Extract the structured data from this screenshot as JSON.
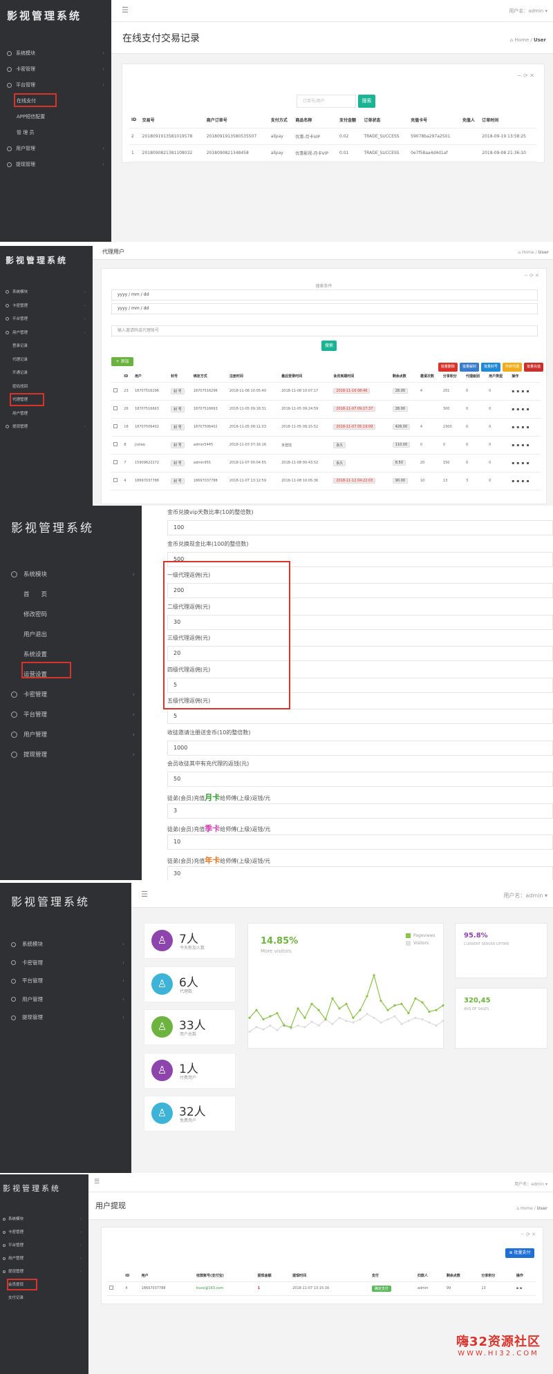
{
  "brand": "影视管理系统",
  "user": "用户名：admin",
  "home": "Home",
  "crumb": "User",
  "s1": {
    "title": "在线支付交易记录",
    "nav": [
      {
        "label": "系统模块"
      },
      {
        "label": "卡密管理"
      },
      {
        "label": "平台管理"
      },
      {
        "label": "在线支付",
        "child": true
      },
      {
        "label": "APP短信配置",
        "child": true
      },
      {
        "label": "管 理 员",
        "child": true
      },
      {
        "label": "用户管理"
      },
      {
        "label": "提现管理"
      }
    ],
    "search_placeholder": "订单号/商户",
    "search_btn": "搜索",
    "headers": [
      "ID",
      "交易号",
      "商户订单号",
      "支付方式",
      "商品名称",
      "支付金额",
      "订单状态",
      "充值卡号",
      "充值人",
      "订单时间"
    ],
    "rows": [
      [
        "2",
        "2018091913581019578",
        "2018091913580535507",
        "alipay",
        "优惠-月卡VIP",
        "0.02",
        "TRADE_SUCCESS",
        "59078ba297a2501",
        "",
        "2018-09-19 13:58:25"
      ],
      [
        "1",
        "2018090821381108032",
        "2018090821348458",
        "alipay",
        "优惠影视-月卡VIP",
        "0.01",
        "TRADE_SUCCESS",
        "0e7f58aa4d4d1af",
        "",
        "2018-09-08 21:36:10"
      ]
    ]
  },
  "s2": {
    "title": "代理用户",
    "nav": [
      {
        "label": "系统模块"
      },
      {
        "label": "卡密管理"
      },
      {
        "label": "平台管理"
      },
      {
        "label": "用户管理"
      },
      {
        "label": "登录记录",
        "child": true
      },
      {
        "label": "代理记录",
        "child": true
      },
      {
        "label": "开通记录",
        "child": true
      },
      {
        "label": "密码找回",
        "child": true
      },
      {
        "label": "代理管理",
        "child": true
      },
      {
        "label": "用户管理",
        "child": true
      },
      {
        "label": "提现管理"
      }
    ],
    "filter_label": "搜索条件",
    "date1": "yyyy / mm / dd",
    "date2": "yyyy / mm / dd",
    "keyword": "输入邀请码或代理账号",
    "search_btn": "搜索",
    "add_btn": "添加",
    "action_btns": [
      {
        "label": "批量删除",
        "color": "#d9342b"
      },
      {
        "label": "批量解封",
        "color": "#3a7ccc"
      },
      {
        "label": "批量封号",
        "color": "#1f89d6"
      },
      {
        "label": "开启代理",
        "color": "#f0ad1e"
      },
      {
        "label": "批量充值",
        "color": "#c9302c"
      }
    ],
    "headers": [
      "",
      "ID",
      "用户",
      "封号",
      "绑定方式",
      "注册时间",
      "最后登录时间",
      "会员到期时间",
      "剩余点数",
      "邀请次数",
      "分享积分",
      "代理级别",
      "用户类型",
      "操作"
    ],
    "rows": [
      [
        "",
        "23",
        "18707516296",
        "封 号",
        "18707516296",
        "2018-11-08 10:05:40",
        "2018-11-08 10:07:17",
        "2018-11-16 08:46",
        "28.00",
        "4",
        "201",
        "0",
        "0"
      ],
      [
        "",
        "26",
        "18707516663",
        "封 号",
        "18707516663",
        "2018-11-05 09:18:31",
        "2018-11-05 09:24:59",
        "2018-11-07 09:27:37",
        "28.00",
        "",
        "300",
        "0",
        "0"
      ],
      [
        "",
        "18",
        "18707506402",
        "封 号",
        "18707506402",
        "2018-11-05 08:11:03",
        "2018-11-05 08:15:52",
        "2018-11-07 05:19:09",
        "426.00",
        "4",
        "2300",
        "0",
        "0"
      ],
      [
        "",
        "8",
        "jiuliao",
        "封 号",
        "admin5445",
        "2018-11-03 07:16:16",
        "未登陆",
        "永久",
        "110.00",
        "0",
        "0",
        "0",
        "0"
      ],
      [
        "",
        "7",
        "15909622272",
        "封 号",
        "admin955",
        "2018-11-07 00:04:55",
        "2018-11-08 00:43:52",
        "永久",
        "8.50",
        "20",
        "150",
        "0",
        "0"
      ],
      [
        "",
        "4",
        "18697037788",
        "封 号",
        "18697037788",
        "2018-11-07 13:12:59",
        "2018-11-08 10:05:36",
        "2018-11-12 04:22:03",
        "90.00",
        "10",
        "13",
        "3",
        "0"
      ]
    ]
  },
  "s3": {
    "nav": [
      {
        "label": "系统模块"
      },
      {
        "label": "首　　页",
        "child": true
      },
      {
        "label": "修改密码",
        "child": true
      },
      {
        "label": "用户退出",
        "child": true
      },
      {
        "label": "系统设置",
        "child": true
      },
      {
        "label": "运营设置",
        "child": true
      },
      {
        "label": "卡密管理"
      },
      {
        "label": "平台管理"
      },
      {
        "label": "用户管理"
      },
      {
        "label": "提现管理"
      }
    ],
    "fields": [
      {
        "label": "金币兑换vip天数比率(10的整倍数)",
        "value": "100"
      },
      {
        "label": "金币兑换现金比率(100的整倍数)",
        "value": "500"
      },
      {
        "label": "一级代理返佣(元)",
        "value": "200"
      },
      {
        "label": "二级代理返佣(元)",
        "value": "30"
      },
      {
        "label": "三级代理返佣(元)",
        "value": "20"
      },
      {
        "label": "四级代理返佣(元)",
        "value": "5"
      },
      {
        "label": "五级代理返佣(元)",
        "value": "5"
      },
      {
        "label": "收徒邀请注册送金币(10的整倍数)",
        "value": "1000"
      },
      {
        "label": "会员收徒其中有充代理的返钱(元)",
        "value": "50"
      },
      {
        "label_pre": "徒弟(会员)充值",
        "label_em": "月卡",
        "em_color": "#2f9a2f",
        "label_post": "给师傅(上级)返钱/元",
        "value": "3"
      },
      {
        "label_pre": "徒弟(会员)充值",
        "label_em": "季卡",
        "em_color": "#d63fb4",
        "label_post": "给师傅(上级)返钱/元",
        "value": "10"
      },
      {
        "label_pre": "徒弟(会员)充值",
        "label_em": "年卡",
        "em_color": "#e8741e",
        "label_post": "给师傅(上级)返钱/元",
        "value": "30"
      }
    ]
  },
  "s4": {
    "nav": [
      {
        "label": "系统模块"
      },
      {
        "label": "卡密管理"
      },
      {
        "label": "平台管理"
      },
      {
        "label": "用户管理"
      },
      {
        "label": "提现管理"
      }
    ],
    "stats": [
      {
        "value": "7人",
        "label": "今天新加入数",
        "color": "#8e44ad"
      },
      {
        "value": "6人",
        "label": "代理数",
        "color": "#3db3d8"
      },
      {
        "value": "33人",
        "label": "用户总数",
        "color": "#6db33f"
      },
      {
        "value": "1人",
        "label": "付费用户",
        "color": "#8e44ad"
      },
      {
        "value": "32人",
        "label": "免费用户",
        "color": "#3db3d8"
      }
    ],
    "chart_pct": "14.85%",
    "chart_sub": "More visitors",
    "legend": [
      {
        "label": "Pageviews",
        "color": "#8bc34a"
      },
      {
        "label": "Visitors",
        "color": "#e0e0e0"
      }
    ],
    "uptime_value": "95.8%",
    "uptime_label": "CURRENT SERVER UPTIME",
    "sales_value": "320,45",
    "sales_label": "AVG OF SALES"
  },
  "s5": {
    "title": "用户提现",
    "nav": [
      {
        "label": "系统模块"
      },
      {
        "label": "卡密管理"
      },
      {
        "label": "平台管理"
      },
      {
        "label": "用户管理"
      },
      {
        "label": "提现管理"
      },
      {
        "label": "会员提现",
        "child": true
      },
      {
        "label": "支付记录",
        "child": true
      }
    ],
    "batch_btn": "批量支付",
    "headers": [
      "",
      "ID",
      "用户",
      "收款账号(支付宝)",
      "提现金额",
      "提现时间",
      "支付",
      "扫款人",
      "剩余点数",
      "分享积分",
      "操作"
    ],
    "rows": [
      [
        "",
        "4",
        "18697037788",
        "buxx@163.com",
        "1",
        "2018-11-07 13:15:16",
        "确定支付",
        "admin",
        "99",
        "13",
        ""
      ]
    ]
  },
  "watermark_cn": "嗨32资源社区",
  "watermark_en": "WWW.HI32.COM",
  "chart_data": {
    "type": "line",
    "series": [
      {
        "name": "Pageviews",
        "values": [
          30,
          40,
          28,
          32,
          36,
          20,
          18,
          42,
          30,
          48,
          40,
          28,
          55,
          42,
          48,
          30,
          40,
          58,
          85,
          52,
          40,
          46,
          48,
          36,
          55,
          50,
          38,
          40,
          46
        ]
      },
      {
        "name": "Visitors",
        "values": [
          12,
          18,
          15,
          20,
          14,
          22,
          16,
          20,
          18,
          25,
          20,
          28,
          22,
          30,
          26,
          24,
          28,
          35,
          30,
          24,
          28,
          32,
          22,
          26,
          30,
          28,
          24,
          20,
          26
        ]
      }
    ]
  }
}
